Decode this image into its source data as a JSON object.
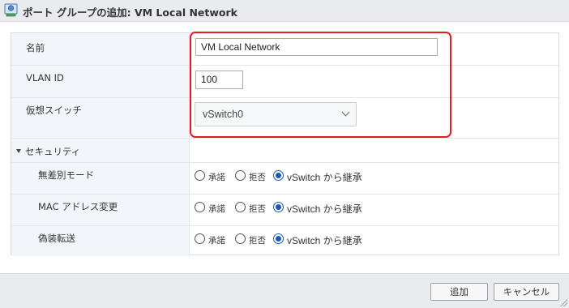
{
  "dialog": {
    "title": "ポート グループの追加: VM Local Network",
    "icon": "port-group-icon"
  },
  "form": {
    "name_label": "名前",
    "name_value": "VM Local Network",
    "vlan_label": "VLAN ID",
    "vlan_value": "100",
    "vswitch_label": "仮想スイッチ",
    "vswitch_selected": "vSwitch0"
  },
  "security": {
    "section_label": "セキュリティ",
    "option_accept": "承諾",
    "option_reject": "拒否",
    "option_inherit": "vSwitch から継承",
    "settings": [
      {
        "label": "無差別モード",
        "selected": "inherit"
      },
      {
        "label": "MAC アドレス変更",
        "selected": "inherit"
      },
      {
        "label": "偽装転送",
        "selected": "inherit"
      }
    ]
  },
  "buttons": {
    "add_label": "追加",
    "cancel_label": "キャンセル"
  },
  "colors": {
    "highlight": "#e01e28",
    "label_bg": "#f2f6fa",
    "radio_checked": "#1e5aa8"
  }
}
